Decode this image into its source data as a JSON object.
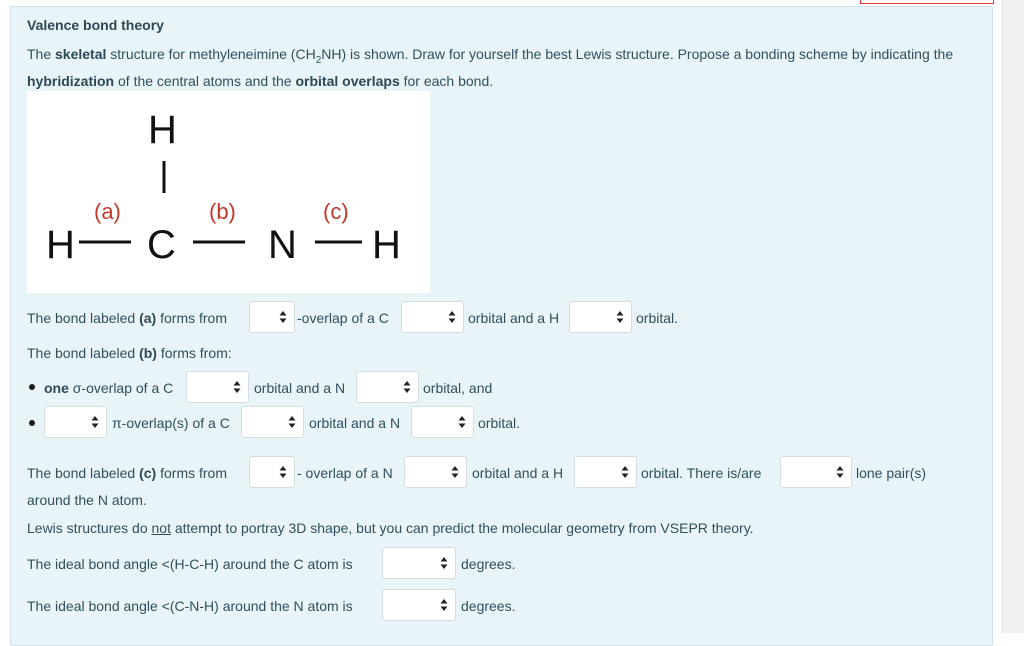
{
  "title": "Valence bond theory",
  "intro": {
    "t1": "The ",
    "b1": "skeletal",
    "t2": " structure for methyleneimine (CH",
    "sub": "2",
    "t3": "NH) is shown.  Draw for yourself the best Lewis structure. Propose a bonding scheme by indicating the ",
    "b2": "hybridization",
    "t4": " of the central atoms and the ",
    "b3": "orbital overlaps",
    "t5": " for each bond."
  },
  "structure": {
    "atoms": [
      "H",
      "H",
      "C",
      "N",
      "H"
    ],
    "labels": [
      "(a)",
      "(b)",
      "(c)"
    ],
    "label_color": "#c0392b"
  },
  "bond_a": {
    "pre": "The bond labeled ",
    "label": "(a)",
    "mid": " forms from",
    "t1": "-overlap of a C",
    "t2": "orbital and a H",
    "t3": "orbital."
  },
  "bond_b": {
    "pre": "The bond labeled ",
    "label": "(b)",
    "mid": " forms from:",
    "item1": {
      "bold": "one",
      "t1": " σ-overlap of a C",
      "t2": "orbital and a N",
      "t3": "orbital, and"
    },
    "item2": {
      "t1": "π-overlap(s) of a C",
      "t2": "orbital and a N",
      "t3": "orbital."
    }
  },
  "bond_c": {
    "pre": "The bond labeled ",
    "label": "(c)",
    "mid": " forms from",
    "t1": "- overlap of a N",
    "t2": "orbital and a H",
    "t3": "orbital.  There is/are",
    "t4": "lone pair(s)",
    "t5": "around the N atom."
  },
  "lewis_note": {
    "t1": "Lewis structures do ",
    "u": "not",
    "t2": " attempt to portray 3D shape, but you can predict the molecular geometry from VSEPR theory."
  },
  "angle_c": {
    "text": "The ideal bond angle <(H-C-H) around the C atom is",
    "unit": "degrees."
  },
  "angle_n": {
    "text": "The ideal bond angle <(C-N-H) around the N atom is",
    "unit": "degrees."
  },
  "dropdowns": {
    "bond_a_type": "",
    "bond_a_c_orbital": "",
    "bond_a_h_orbital": "",
    "bond_b_sigma_c": "",
    "bond_b_sigma_n": "",
    "bond_b_pi_count": "",
    "bond_b_pi_c": "",
    "bond_b_pi_n": "",
    "bond_c_type": "",
    "bond_c_n_orbital": "",
    "bond_c_h_orbital": "",
    "lone_pairs": "",
    "angle_hch": "",
    "angle_cnh": ""
  }
}
